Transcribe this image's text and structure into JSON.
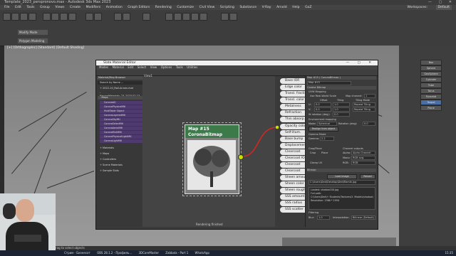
{
  "app": {
    "window_title": "Template_2023_perspronovo.max - Autodesk 3ds Max 2023",
    "menu": [
      "File",
      "Edit",
      "Tools",
      "Group",
      "Views",
      "Create",
      "Modifiers",
      "Animation",
      "Graph Editors",
      "Rendering",
      "Customize",
      "Civil View",
      "Scripting",
      "Substance",
      "V-Ray",
      "Arnold",
      "Help",
      "GoZ"
    ],
    "workspace_label": "Workspaces:",
    "workspace_value": "Default",
    "ribbon_dropdown1": "Modify Mode",
    "ribbon_dropdown2": "Polygon Modeling",
    "viewport_label": "[+] [Orthographic] [Standard] [Default Shading]",
    "status_text": "Click or click-and-drag to select objects",
    "right_panel_buttons": [
      "Box",
      "Sphere",
      "GeoSphere",
      "Cylinder",
      "Tube",
      "Torus",
      "Pyramid",
      "Teapot",
      "Plane"
    ],
    "taskbar_items": [
      "Стрим - Бизнесот",
      "OBS 28.1.2 - Профиль...",
      "3DCoreMaster",
      "Zabbala - Part 1",
      "WhatsApp"
    ],
    "clock": "15:35"
  },
  "sme": {
    "title": "Slate Material Editor",
    "menu": [
      "Modes",
      "Material",
      "Edit",
      "Select",
      "View",
      "Options",
      "Tools",
      "Utilities"
    ],
    "view_tab": "View1",
    "browser": {
      "header": "Material/Map Browser",
      "search_placeholder": "Search by Name ...",
      "group_items": [
        "+ 2022-10_Roll-Annex.mat",
        "- KoronaMaterials_23_2023.02.13..."
      ],
      "maps_header": "- Maps",
      "maps": [
        "CoronaAO",
        "CoronaPhysicalMtl",
        "MultiTable Object",
        "CoronaLayeredMtl",
        "CoronaSkyMtl",
        "CoronaSelectMtl",
        "CoronaAerialMtl",
        "CoronaMultiMtl",
        "CoronaPhysicalLightMtl",
        "CoronaLightMtl"
      ],
      "sections": [
        "+ Materials",
        "+ Maps",
        "+ Controllers",
        "+ Scene Materials",
        "+ Sample Slots"
      ]
    },
    "node": {
      "title": "Map #15",
      "type": "CoronaBitmap"
    },
    "params": [
      "Base IOR",
      "Edge color",
      "Transl. fraction",
      "Transl. color",
      "Metalness",
      "Refraction",
      "Thin absorp.",
      "Opacity color",
      "Self-illum.",
      "Base bump",
      "Displacement",
      "Clearcoat",
      "Clearcoat IOR",
      "Clearcoat",
      "Clearcoat",
      "Sheen amount",
      "Sheen color",
      "Sheen rough.",
      "SSS amount",
      "SSS radius",
      "SSS scatter"
    ],
    "nav_label": "Rendering finished",
    "props": {
      "header": "Map #15 ( CoronaBitmap )",
      "sub": "Map #15",
      "rollout": "Corona Bitmap",
      "uvw_mapping": "UVW Mapping",
      "use_real_world": "Use Real-World Scale",
      "map_channel_label": "Map channel:",
      "map_channel": "1",
      "offset_label": "Offset",
      "tiling_label": "Tiling",
      "tiling_mode": "Tiling Mode",
      "u_offset": "0.0",
      "v_offset": "0.0",
      "u_tiling": "1.0",
      "v_tiling": "1.0",
      "repeat": "Repeat Tiling",
      "w_rotation_label": "W rotation (deg):",
      "w_rotation": "0.0",
      "env_mapping": "Environment mapping",
      "mode_label": "Mode:",
      "mode": "Spherical",
      "rotation_label": "Rotation (deg):",
      "rotation": "0.0",
      "realign": "Realign from object",
      "gamma_mode": "Gamma Mode",
      "gamma_label": "Gamma:",
      "gamma": "2.2",
      "crop_place": "Crop/Place",
      "crop": "Crop",
      "place": "Place",
      "channel_outputs": "Channel outputs",
      "alpha_label": "Alpha:",
      "alpha": "Alpha Channel",
      "mono_label": "Mono:",
      "mono": "RGB avg.",
      "rgb_label": "RGB:",
      "rgb": "RGB",
      "clamp": "Clamp UV",
      "bitmap_header": "Bitmap",
      "load_image": "Load Image",
      "reload": "Reload",
      "path_short": "C:\\Users\\Ded\\Desktop\\Ded\\Ramik.jpg",
      "loaded_lines": [
        "Loaded: shadow150.jpg",
        "Full path:",
        "C:\\Users\\Ded\\+ Students\\Textures\\3. Models\\shadow\\01.jpg",
        "Resolution: 1366 * 1950"
      ],
      "filtering": "Filtering",
      "blur_label": "Blur:",
      "blur": "1.0",
      "interp_label": "Interpolation:",
      "interp": "Bilinear (Default)"
    }
  }
}
